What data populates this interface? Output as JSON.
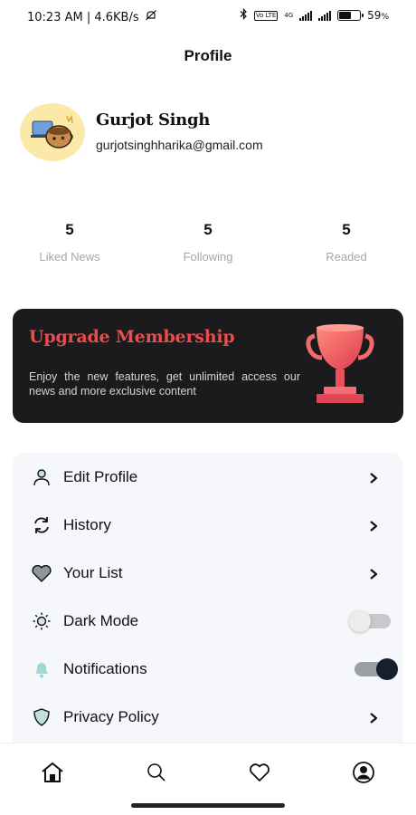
{
  "status_bar": {
    "time_speed": "10:23 AM | 4.6KB/s",
    "volte_badge": "Vo LTE",
    "network_badge": "4G",
    "battery_text": "59",
    "battery_unit": "%",
    "battery_level": 0.59
  },
  "header": {
    "title": "Profile"
  },
  "profile": {
    "name": "Gurjot Singh",
    "email": "gurjotsinghharika@gmail.com"
  },
  "stats": [
    {
      "value": "5",
      "label": "Liked News"
    },
    {
      "value": "5",
      "label": "Following"
    },
    {
      "value": "5",
      "label": "Readed"
    }
  ],
  "upgrade": {
    "title": "Upgrade Membership",
    "description": "Enjoy the new features, get unlimited access our news and more exclusive content"
  },
  "menu": {
    "items": [
      {
        "label": "Edit Profile",
        "icon": "user-icon",
        "trailing": "chevron"
      },
      {
        "label": "History",
        "icon": "refresh-icon",
        "trailing": "chevron"
      },
      {
        "label": "Your List",
        "icon": "heart-icon",
        "trailing": "chevron"
      },
      {
        "label": "Dark Mode",
        "icon": "sun-icon",
        "trailing": "toggle",
        "on": false
      },
      {
        "label": "Notifications",
        "icon": "bell-icon",
        "trailing": "toggle",
        "on": true
      },
      {
        "label": "Privacy Policy",
        "icon": "shield-icon",
        "trailing": "chevron"
      }
    ]
  },
  "bottom_nav": [
    "home-icon",
    "search-icon",
    "heart-icon",
    "profile-icon"
  ],
  "colors": {
    "accent_red": "#ef4b4b",
    "card_dark": "#1b1b1d",
    "menu_bg": "#f5f7fa",
    "muted": "#a7a7ab"
  }
}
